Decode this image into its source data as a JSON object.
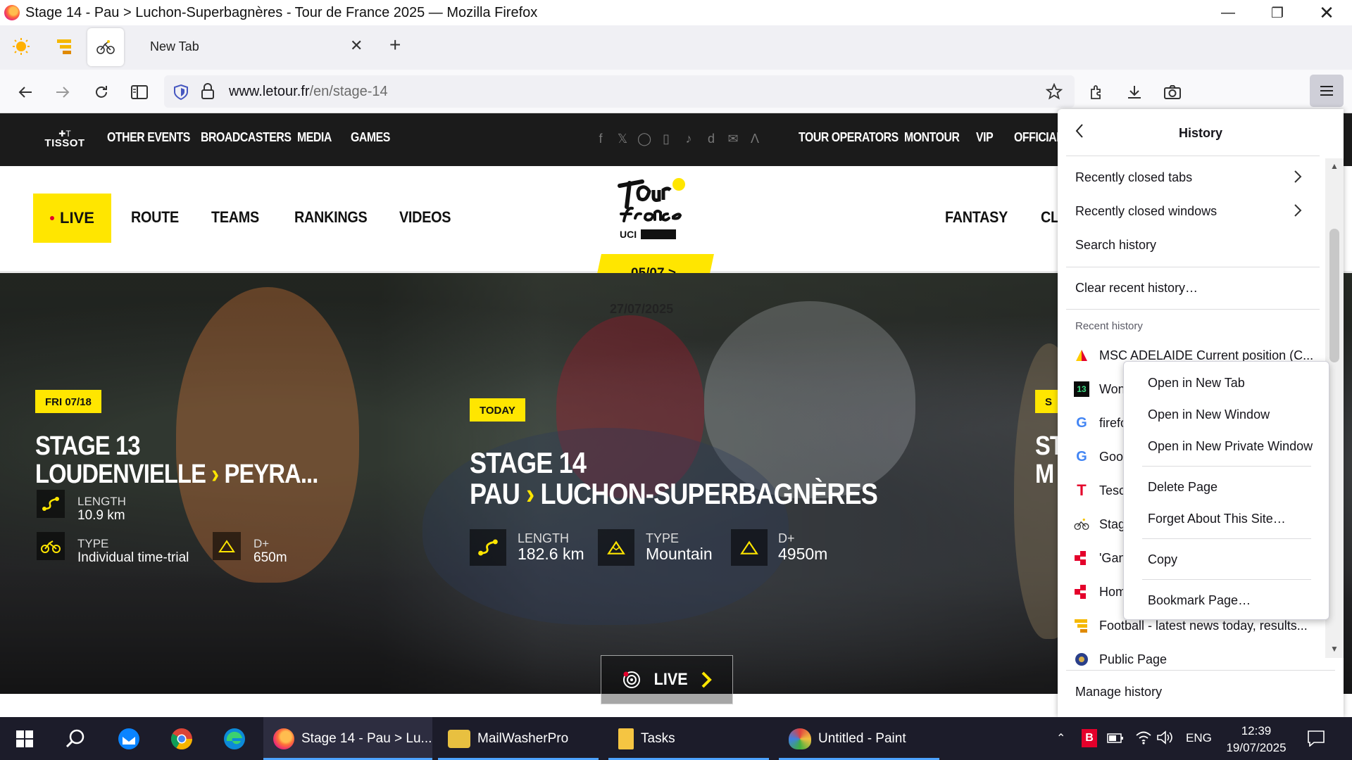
{
  "window": {
    "title": "Stage 14 - Pau > Luchon-Superbagnères - Tour de France 2025 — Mozilla Firefox"
  },
  "tabs": {
    "new_tab_label": "New Tab"
  },
  "urlbar": {
    "domain": "www.letour.fr",
    "path": "/en/stage-14"
  },
  "site": {
    "topbar": {
      "brand": "TISSOT",
      "links": [
        "OTHER EVENTS",
        "BROADCASTERS",
        "MEDIA",
        "GAMES"
      ],
      "right_links": [
        "TOUR OPERATORS",
        "MONTOUR",
        "VIP",
        "OFFICIAL"
      ]
    },
    "nav": {
      "live": "LIVE",
      "items": [
        "ROUTE",
        "TEAMS",
        "RANKINGS",
        "VIDEOS"
      ],
      "right_items": [
        "FANTASY",
        "CL"
      ]
    },
    "logo_sub": "UCI",
    "date_tag": "05/07 >",
    "date_end": "27/07/2025",
    "stages": [
      {
        "badge": "FRI 07/18",
        "line1": "STAGE 13",
        "from": "LOUDENVIELLE",
        "arrow": "›",
        "to": "PEYRA...",
        "length_label": "LENGTH",
        "length": "10.9 km",
        "type_label": "TYPE",
        "type": "Individual time-trial",
        "dplus_label": "D+",
        "dplus": "650m"
      },
      {
        "badge": "TODAY",
        "line1": "STAGE 14",
        "from": "PAU",
        "arrow": "›",
        "to": "LUCHON-SUPERBAGNÈRES",
        "length_label": "LENGTH",
        "length": "182.6 km",
        "type_label": "TYPE",
        "type": "Mountain",
        "dplus_label": "D+",
        "dplus": "4950m"
      },
      {
        "badge": "S",
        "line1": "ST",
        "line2": "M"
      }
    ],
    "live_cta": "LIVE"
  },
  "history_panel": {
    "title": "History",
    "items": [
      "Recently closed tabs",
      "Recently closed windows",
      "Search history"
    ],
    "clear": "Clear recent history…",
    "recent_header": "Recent history",
    "recent": [
      {
        "icon": "flag-icon",
        "text": "MSC ADELAIDE Current position (C..."
      },
      {
        "icon": "game-icon",
        "text": "Won'"
      },
      {
        "icon": "google-icon",
        "text": "firefo"
      },
      {
        "icon": "google-icon",
        "text": "Goog"
      },
      {
        "icon": "tesco-icon",
        "text": "Tesco"
      },
      {
        "icon": "tour-icon",
        "text": "Stage"
      },
      {
        "icon": "red-icon",
        "text": "'Gang"
      },
      {
        "icon": "red-icon",
        "text": "Home"
      },
      {
        "icon": "yellow-icon",
        "text": "Football - latest news today, results..."
      },
      {
        "icon": "globe-icon",
        "text": "Public Page"
      }
    ],
    "manage": "Manage history"
  },
  "context_menu": {
    "items": [
      "Open in New Tab",
      "Open in New Window",
      "Open in New Private Window",
      "Delete Page",
      "Forget About This Site…",
      "Copy",
      "Bookmark Page…"
    ]
  },
  "taskbar": {
    "apps": [
      "Stage 14 - Pau > Lu...",
      "MailWasherPro",
      "Tasks",
      "Untitled - Paint"
    ],
    "lang": "ENG",
    "time": "12:39",
    "date": "19/07/2025"
  },
  "colors": {
    "tdf_yellow": "#ffe600",
    "firefox_accent": "#0060df"
  }
}
